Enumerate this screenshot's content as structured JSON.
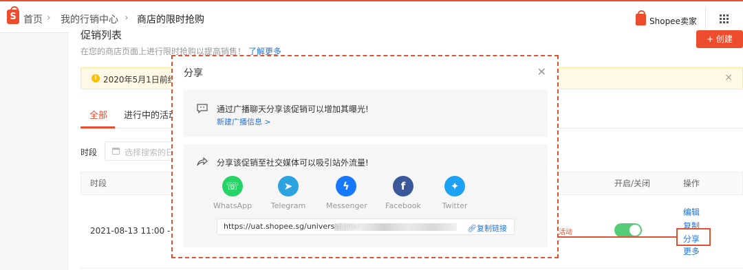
{
  "breadcrumb": {
    "home": "首页",
    "marketing": "我的行销中心",
    "current": "商店的限时抢购"
  },
  "header": {
    "seller_label": "Shopee卖家"
  },
  "promo": {
    "title": "促销列表",
    "description": "在您的商店页面上进行限时抢购以提高销售！",
    "learn_more": "了解更多",
    "create_button": "+ 创建"
  },
  "notice": {
    "text": "2020年5月1日前结束"
  },
  "tabs": [
    {
      "label": "全部"
    },
    {
      "label": "进行中的活动"
    }
  ],
  "filter": {
    "label": "时段",
    "placeholder": "选择搜索的日"
  },
  "table": {
    "columns": {
      "period": "时段",
      "toggle": "开启/关闭",
      "actions": "操作"
    },
    "row": {
      "time": "2021-08-13 11:00 - 13:0",
      "status": "活动",
      "toggle_on": true,
      "actions": {
        "edit": "编辑",
        "copy": "复制",
        "share": "分享",
        "more": "更多"
      }
    }
  },
  "modal": {
    "title": "分享",
    "broadcast_text": "通过广播聊天分享该促销可以增加其曝光!",
    "broadcast_link": "新建广播信息 >",
    "social_text": "分享该促销至社交媒体可以吸引站外流量!",
    "social": [
      {
        "label": "WhatsApp",
        "color": "#25d366",
        "icon": "whatsapp-icon"
      },
      {
        "label": "Telegram",
        "color": "#2aa3df",
        "icon": "telegram-icon"
      },
      {
        "label": "Messenger",
        "color": "#1677ff",
        "icon": "messenger-icon"
      },
      {
        "label": "Facebook",
        "color": "#3b5998",
        "icon": "facebook-icon"
      },
      {
        "label": "Twitter",
        "color": "#1da1f2",
        "icon": "twitter-icon"
      }
    ],
    "link_url": "https://uat.shopee.sg/universal-link/",
    "copy_link": "复制链接"
  },
  "colors": {
    "brand": "#ee4d2d",
    "link": "#2673dd",
    "annotation": "#e0502d"
  }
}
